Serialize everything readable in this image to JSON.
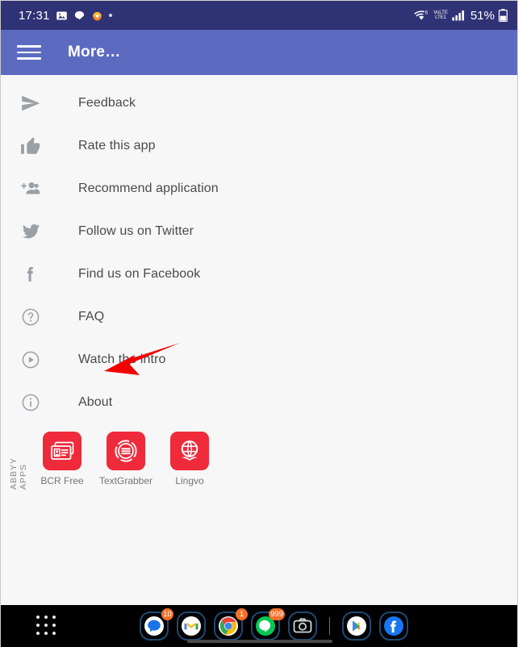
{
  "status_bar": {
    "time": "17:31",
    "battery_percent": "51%",
    "wifi_label": "6",
    "network_label_top": "VoLTE",
    "network_label_bottom": "LTE1",
    "icons": [
      "photos-icon",
      "line-messenger-icon",
      "alarm-icon",
      "dot-icon",
      "wifi-icon",
      "volte-icon",
      "signal-icon",
      "battery-icon"
    ],
    "colors": {
      "background": "#2f3275",
      "foreground": "#ffffff"
    }
  },
  "app_bar": {
    "title": "More…",
    "menu_icon": "hamburger-menu-icon",
    "colors": {
      "background": "#5c6bc0",
      "title": "#ffffff"
    }
  },
  "menu": {
    "items": [
      {
        "label": "Feedback",
        "icon": "send-icon"
      },
      {
        "label": "Rate this app",
        "icon": "thumbs-up-icon"
      },
      {
        "label": "Recommend application",
        "icon": "person-add-icon"
      },
      {
        "label": "Follow us on Twitter",
        "icon": "twitter-icon"
      },
      {
        "label": "Find us on Facebook",
        "icon": "facebook-icon"
      },
      {
        "label": "FAQ",
        "icon": "help-circle-icon"
      },
      {
        "label": "Watch the intro",
        "icon": "play-circle-icon"
      },
      {
        "label": "About",
        "icon": "info-circle-icon"
      }
    ]
  },
  "abbyy_apps": {
    "section_label": "ABBYY APPS",
    "tile_color": "#ef2a3a",
    "items": [
      {
        "name": "BCR Free",
        "icon": "business-card-icon"
      },
      {
        "name": "TextGrabber",
        "icon": "text-lines-circle-icon"
      },
      {
        "name": "Lingvo",
        "icon": "globe-book-icon"
      }
    ]
  },
  "annotation": {
    "type": "arrow",
    "color": "#f20000",
    "points_to": "About",
    "from": "222,468",
    "to": "128,503"
  },
  "dock": {
    "all_apps_icon": "app-drawer-grid-icon",
    "items": [
      {
        "name": "Messages",
        "icon": "messages-icon",
        "badge": "10"
      },
      {
        "name": "Gmail",
        "icon": "gmail-icon",
        "badge": ""
      },
      {
        "name": "Chrome",
        "icon": "chrome-icon",
        "badge": "1"
      },
      {
        "name": "LINE",
        "icon": "line-icon",
        "badge": "999"
      },
      {
        "name": "Camera",
        "icon": "camera-icon",
        "badge": ""
      },
      {
        "name": "Play Store",
        "icon": "play-store-icon",
        "badge": ""
      },
      {
        "name": "Facebook",
        "icon": "facebook-round-icon",
        "badge": ""
      }
    ],
    "background": "#000000"
  }
}
